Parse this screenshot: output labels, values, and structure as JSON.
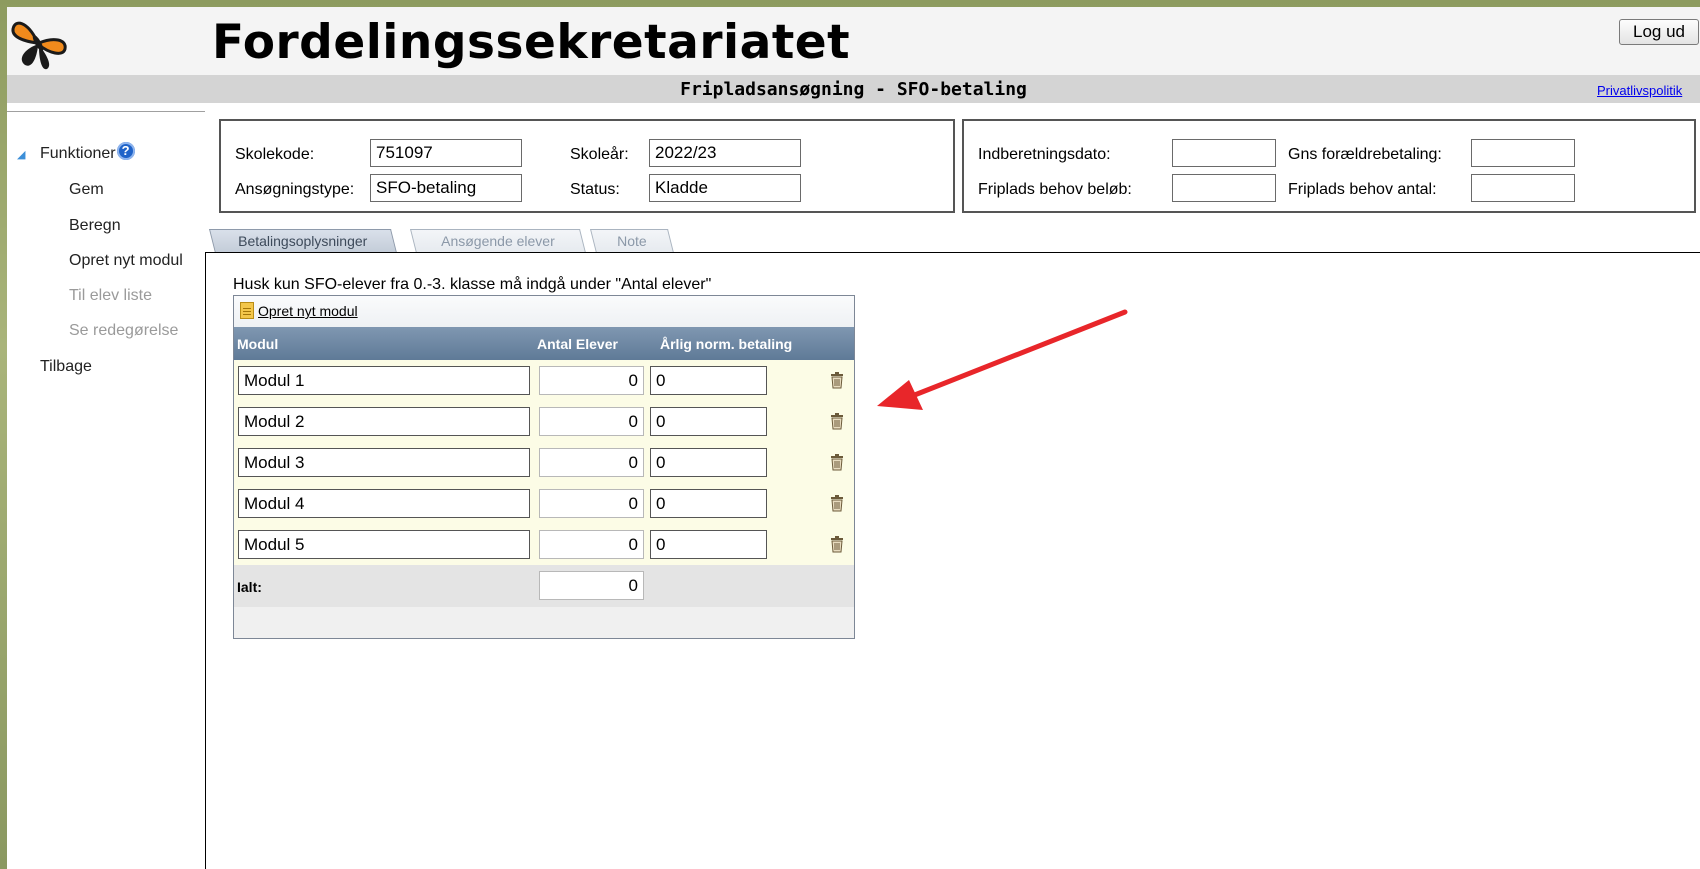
{
  "header": {
    "app_title": "Fordelingssekretariatet",
    "logout_label": "Log ud",
    "subtitle": "Fripladsansøgning - SFO-betaling",
    "privacy_link": "Privatlivspolitik"
  },
  "sidebar": {
    "group_label": "Funktioner",
    "help_glyph": "?",
    "items": [
      {
        "label": "Gem",
        "enabled": true
      },
      {
        "label": "Beregn",
        "enabled": true
      },
      {
        "label": "Opret nyt modul",
        "enabled": true
      },
      {
        "label": "Til elev liste",
        "enabled": false
      },
      {
        "label": "Se redegørelse",
        "enabled": false
      }
    ],
    "back_label": "Tilbage"
  },
  "info_left": {
    "skolekode_label": "Skolekode:",
    "skolekode_value": "751097",
    "skoleaar_label": "Skoleår:",
    "skoleaar_value": "2022/23",
    "ansoegningstype_label": "Ansøgningstype:",
    "ansoegningstype_value": "SFO-betaling",
    "status_label": "Status:",
    "status_value": "Kladde"
  },
  "info_right": {
    "indberetningsdato_label": "Indberetningsdato:",
    "indberetningsdato_value": "",
    "gns_label": "Gns forældrebetaling:",
    "gns_value": "",
    "friplads_beloeb_label": "Friplads behov beløb:",
    "friplads_beloeb_value": "",
    "friplads_antal_label": "Friplads behov antal:",
    "friplads_antal_value": ""
  },
  "tabs": [
    {
      "label": "Betalingsoplysninger",
      "active": true
    },
    {
      "label": "Ansøgende elever",
      "active": false
    },
    {
      "label": "Note",
      "active": false
    }
  ],
  "main": {
    "hint": "Husk kun SFO-elever fra 0.-3. klasse må indgå under \"Antal elever\"",
    "new_module_link": "Opret nyt modul",
    "columns": [
      "Modul",
      "Antal Elever",
      "Årlig norm. betaling"
    ],
    "rows": [
      {
        "modul": "Modul 1",
        "antal": "0",
        "betaling": "0"
      },
      {
        "modul": "Modul 2",
        "antal": "0",
        "betaling": "0"
      },
      {
        "modul": "Modul 3",
        "antal": "0",
        "betaling": "0"
      },
      {
        "modul": "Modul 4",
        "antal": "0",
        "betaling": "0"
      },
      {
        "modul": "Modul 5",
        "antal": "0",
        "betaling": "0"
      }
    ],
    "total_label": "Ialt:",
    "total_value": "0"
  },
  "icons": {
    "logo": "butterfly-logo-icon",
    "row_delete": "trash-icon",
    "new_module": "document-icon",
    "annotation": "red-arrow-icon"
  },
  "colors": {
    "table_header": "#6a84a1",
    "table_body": "#fcfce6",
    "annotation_arrow": "#e8262a",
    "help_icon": "#1f63c9"
  }
}
